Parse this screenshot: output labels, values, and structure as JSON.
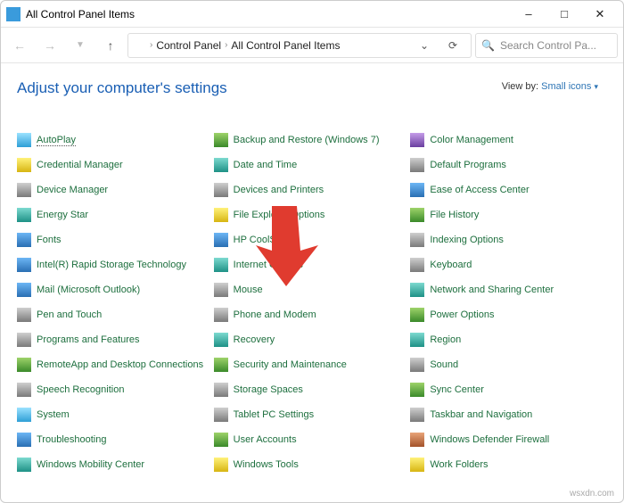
{
  "title": "All Control Panel Items",
  "address": {
    "root": "Control Panel",
    "current": "All Control Panel Items"
  },
  "search": {
    "placeholder": "Search Control Pa..."
  },
  "heading": "Adjust your computer's settings",
  "viewby": {
    "label": "View by:",
    "mode": "Small icons"
  },
  "watermark": "wsxdn.com",
  "items": {
    "c0": [
      {
        "label": "AutoPlay",
        "icon": "ic-cyan",
        "selected": true
      },
      {
        "label": "Credential Manager",
        "icon": "ic-yellow"
      },
      {
        "label": "Device Manager",
        "icon": "ic-gray"
      },
      {
        "label": "Energy Star",
        "icon": "ic-teal"
      },
      {
        "label": "Fonts",
        "icon": "ic-blue"
      },
      {
        "label": "Intel(R) Rapid Storage Technology",
        "icon": "ic-blue"
      },
      {
        "label": "Mail (Microsoft Outlook)",
        "icon": "ic-blue"
      },
      {
        "label": "Pen and Touch",
        "icon": "ic-gray"
      },
      {
        "label": "Programs and Features",
        "icon": "ic-gray"
      },
      {
        "label": "RemoteApp and Desktop Connections",
        "icon": "ic-green"
      },
      {
        "label": "Speech Recognition",
        "icon": "ic-gray"
      },
      {
        "label": "System",
        "icon": "ic-cyan"
      },
      {
        "label": "Troubleshooting",
        "icon": "ic-blue"
      },
      {
        "label": "Windows Mobility Center",
        "icon": "ic-teal"
      }
    ],
    "c1": [
      {
        "label": "Backup and Restore (Windows 7)",
        "icon": "ic-green"
      },
      {
        "label": "Date and Time",
        "icon": "ic-teal"
      },
      {
        "label": "Devices and Printers",
        "icon": "ic-gray"
      },
      {
        "label": "File Explorer Options",
        "icon": "ic-yellow"
      },
      {
        "label": "HP CoolSense",
        "icon": "ic-blue"
      },
      {
        "label": "Internet Options",
        "icon": "ic-teal"
      },
      {
        "label": "Mouse",
        "icon": "ic-gray"
      },
      {
        "label": "Phone and Modem",
        "icon": "ic-gray"
      },
      {
        "label": "Recovery",
        "icon": "ic-teal"
      },
      {
        "label": "Security and Maintenance",
        "icon": "ic-green"
      },
      {
        "label": "Storage Spaces",
        "icon": "ic-gray"
      },
      {
        "label": "Tablet PC Settings",
        "icon": "ic-gray"
      },
      {
        "label": "User Accounts",
        "icon": "ic-green"
      },
      {
        "label": "Windows Tools",
        "icon": "ic-yellow"
      }
    ],
    "c2": [
      {
        "label": "Color Management",
        "icon": "ic-purple"
      },
      {
        "label": "Default Programs",
        "icon": "ic-gray"
      },
      {
        "label": "Ease of Access Center",
        "icon": "ic-blue"
      },
      {
        "label": "File History",
        "icon": "ic-green"
      },
      {
        "label": "Indexing Options",
        "icon": "ic-gray"
      },
      {
        "label": "Keyboard",
        "icon": "ic-gray"
      },
      {
        "label": "Network and Sharing Center",
        "icon": "ic-teal"
      },
      {
        "label": "Power Options",
        "icon": "ic-green"
      },
      {
        "label": "Region",
        "icon": "ic-teal"
      },
      {
        "label": "Sound",
        "icon": "ic-gray"
      },
      {
        "label": "Sync Center",
        "icon": "ic-green"
      },
      {
        "label": "Taskbar and Navigation",
        "icon": "ic-gray"
      },
      {
        "label": "Windows Defender Firewall",
        "icon": "ic-brick"
      },
      {
        "label": "Work Folders",
        "icon": "ic-yellow"
      }
    ]
  }
}
